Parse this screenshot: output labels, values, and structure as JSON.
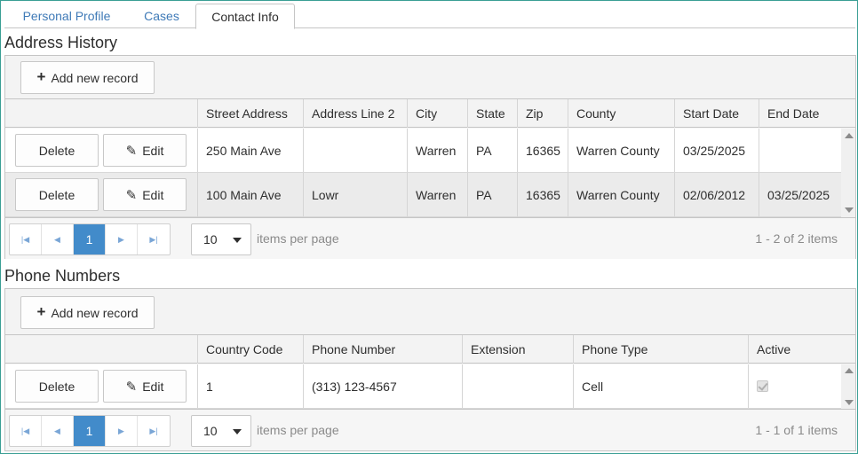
{
  "tabs": [
    {
      "label": "Personal Profile"
    },
    {
      "label": "Cases"
    },
    {
      "label": "Contact Info"
    }
  ],
  "address": {
    "title": "Address History",
    "add_label": "Add new record",
    "columns": [
      "Street Address",
      "Address Line 2",
      "City",
      "State",
      "Zip",
      "County",
      "Start Date",
      "End Date"
    ],
    "rows": [
      {
        "street": "250 Main Ave",
        "line2": "",
        "city": "Warren",
        "state": "PA",
        "zip": "16365",
        "county": "Warren County",
        "start": "03/25/2025",
        "end": ""
      },
      {
        "street": "100 Main Ave",
        "line2": "Lowr",
        "city": "Warren",
        "state": "PA",
        "zip": "16365",
        "county": "Warren County",
        "start": "02/06/2012",
        "end": "03/25/2025"
      }
    ],
    "pager": {
      "page": "1",
      "page_size": "10",
      "items_per_page": "items per page",
      "info": "1 - 2 of 2 items"
    }
  },
  "phone": {
    "title": "Phone Numbers",
    "add_label": "Add new record",
    "columns": [
      "Country Code",
      "Phone Number",
      "Extension",
      "Phone Type",
      "Active"
    ],
    "rows": [
      {
        "country_code": "1",
        "number": "(313) 123-4567",
        "extension": "",
        "type": "Cell",
        "active": true
      }
    ],
    "pager": {
      "page": "1",
      "page_size": "10",
      "items_per_page": "items per page",
      "info": "1 - 1 of 1 items"
    }
  },
  "row_actions": {
    "delete": "Delete",
    "edit": "Edit"
  },
  "colors": {
    "accent": "#428bca",
    "tab_link": "#3f7ab7",
    "frame": "#3a9e94"
  }
}
